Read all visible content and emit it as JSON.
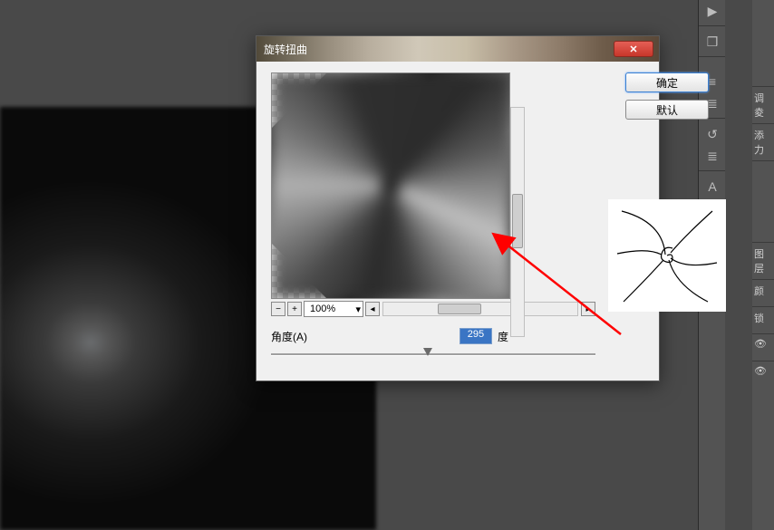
{
  "dialog": {
    "title": "旋转扭曲",
    "ok_button": "确定",
    "default_button": "默认",
    "zoom_minus": "−",
    "zoom_plus": "+",
    "zoom_value": "100%",
    "angle_label": "角度(A)",
    "angle_value": "295",
    "angle_unit": "度"
  },
  "right_panel": {
    "item1": "调夌",
    "item2": "添力",
    "item3": "图层",
    "item4": "颜",
    "item5": "锁"
  },
  "icons": {
    "play": "▶",
    "cube": "❒",
    "faders": "≡",
    "list": "≣",
    "history": "↺",
    "text": "A",
    "paragraph": "¶",
    "box3d": "◫"
  }
}
